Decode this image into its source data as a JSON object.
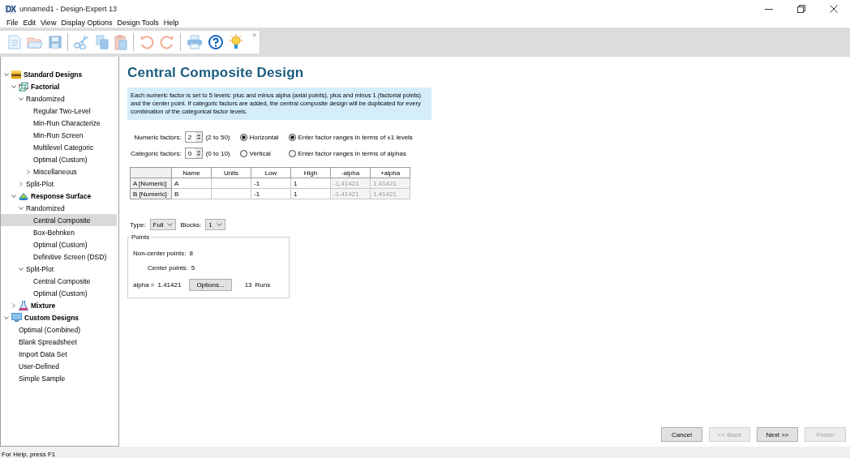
{
  "window": {
    "logo": "DX",
    "title": "unnamed1 - Design-Expert 13"
  },
  "menu": [
    "File",
    "Edit",
    "View",
    "Display Options",
    "Design Tools",
    "Help"
  ],
  "toolbar": {
    "buttons": [
      {
        "kind": "new"
      },
      {
        "kind": "open"
      },
      {
        "kind": "save"
      },
      {
        "kind": "cut"
      },
      {
        "kind": "copy"
      },
      {
        "kind": "paste"
      },
      {
        "kind": "undo"
      },
      {
        "kind": "redo"
      },
      {
        "kind": "print"
      },
      {
        "kind": "help"
      },
      {
        "kind": "tip"
      }
    ],
    "overflow": "»"
  },
  "tree": [
    {
      "label": "Standard Designs",
      "kind": "standard",
      "expanded": true,
      "selected": false,
      "children": [
        {
          "label": "Factorial",
          "kind": "factorial",
          "expanded": true,
          "selected": false,
          "children": [
            {
              "label": "Randomized",
              "kind": "branch",
              "expanded": true,
              "selected": false,
              "children": [
                {
                  "label": "Regular Two-Level",
                  "kind": "leaf",
                  "selected": false
                },
                {
                  "label": "Min-Run Characterize",
                  "kind": "leaf",
                  "selected": false
                },
                {
                  "label": "Min-Run Screen",
                  "kind": "leaf",
                  "selected": false
                },
                {
                  "label": "Multilevel Categoric",
                  "kind": "leaf",
                  "selected": false
                },
                {
                  "label": "Optimal (Custom)",
                  "kind": "leaf",
                  "selected": false
                },
                {
                  "label": "Miscellaneous",
                  "kind": "branch",
                  "expanded": false,
                  "selected": false
                }
              ]
            },
            {
              "label": "Split-Plot",
              "kind": "branch",
              "expanded": false,
              "selected": false
            }
          ]
        },
        {
          "label": "Response Surface",
          "kind": "surface",
          "expanded": true,
          "selected": false,
          "children": [
            {
              "label": "Randomized",
              "kind": "branch",
              "expanded": true,
              "selected": false,
              "children": [
                {
                  "label": "Central Composite",
                  "kind": "leaf",
                  "selected": true
                },
                {
                  "label": "Box-Behnken",
                  "kind": "leaf",
                  "selected": false
                },
                {
                  "label": "Optimal (Custom)",
                  "kind": "leaf",
                  "selected": false
                },
                {
                  "label": "Definitive Screen (DSD)",
                  "kind": "leaf",
                  "selected": false
                }
              ]
            },
            {
              "label": "Split-Plot",
              "kind": "branch",
              "expanded": true,
              "selected": false,
              "children": [
                {
                  "label": "Central Composite",
                  "kind": "leaf",
                  "selected": false
                },
                {
                  "label": "Optimal (Custom)",
                  "kind": "leaf",
                  "selected": false
                }
              ]
            }
          ]
        },
        {
          "label": "Mixture",
          "kind": "mixture",
          "expanded": false,
          "selected": false
        }
      ]
    },
    {
      "label": "Custom Designs",
      "kind": "custom",
      "expanded": true,
      "selected": false,
      "children": [
        {
          "label": "Optimal (Combined)",
          "kind": "leaf",
          "selected": false
        },
        {
          "label": "Blank Spreadsheet",
          "kind": "leaf",
          "selected": false
        },
        {
          "label": "Import Data Set",
          "kind": "leaf",
          "selected": false
        },
        {
          "label": "User-Defined",
          "kind": "leaf",
          "selected": false
        },
        {
          "label": "Simple Sample",
          "kind": "leaf",
          "selected": false
        }
      ]
    }
  ],
  "panel": {
    "title": "Central Composite Design",
    "description": "Each numeric factor is set to 5 levels: plus and minus alpha (axial points), plus and minus 1 (factorial points) and the center point. If categoric factors are added, the central composite design will be duplicated for every combination of the categorical factor levels.",
    "factor_inputs": [
      {
        "label": "Numeric factors:",
        "value": "2",
        "range": "(2 to 50)"
      },
      {
        "label": "Categoric factors:",
        "value": "0",
        "range": "(0 to 10)"
      }
    ],
    "layout_options": [
      {
        "label": "Horizontal",
        "selected": true
      },
      {
        "label": "Vertical",
        "selected": false
      }
    ],
    "range_options": [
      {
        "label": "Enter factor ranges in terms of ±1 levels",
        "selected": true
      },
      {
        "label": "Enter factor ranges in terms of alphas",
        "selected": false
      }
    ],
    "table": {
      "columns": [
        "Name",
        "Units",
        "Low",
        "High",
        "-alpha",
        "+alpha"
      ],
      "rows": [
        {
          "header": "A [Numeric]",
          "cells": [
            {
              "text": "A",
              "readonly": false
            },
            {
              "readonly": false
            },
            {
              "text": "-1",
              "readonly": false
            },
            {
              "text": "1",
              "readonly": false
            },
            {
              "text": "-1.41421",
              "readonly": true
            },
            {
              "text": "1.41421",
              "readonly": true
            }
          ]
        },
        {
          "header": "B [Numeric]",
          "cells": [
            {
              "text": "B",
              "readonly": false
            },
            {
              "readonly": false
            },
            {
              "text": "-1",
              "readonly": false
            },
            {
              "text": "1",
              "readonly": false
            },
            {
              "text": "-1.41421",
              "readonly": true
            },
            {
              "text": "1.41421",
              "readonly": true
            }
          ]
        }
      ]
    },
    "type": {
      "label": "Type:",
      "value": "Full"
    },
    "blocks": {
      "label": "Blocks:",
      "value": "1"
    },
    "points": {
      "title": "Points",
      "non_center_label": "Non-center points:",
      "non_center": "8",
      "center_label": "Center points:",
      "center": "5",
      "alpha_label": "alpha =",
      "alpha": "1.41421",
      "options_button": "Options...",
      "runs": "13",
      "runs_label": "Runs"
    }
  },
  "buttons": [
    {
      "label": "Cancel",
      "disabled": false
    },
    {
      "label": "<< Back",
      "disabled": true
    },
    {
      "label": "Next >>",
      "disabled": false
    },
    {
      "label": "Finish",
      "disabled": true
    }
  ],
  "status_bar": "For Help, press F1"
}
